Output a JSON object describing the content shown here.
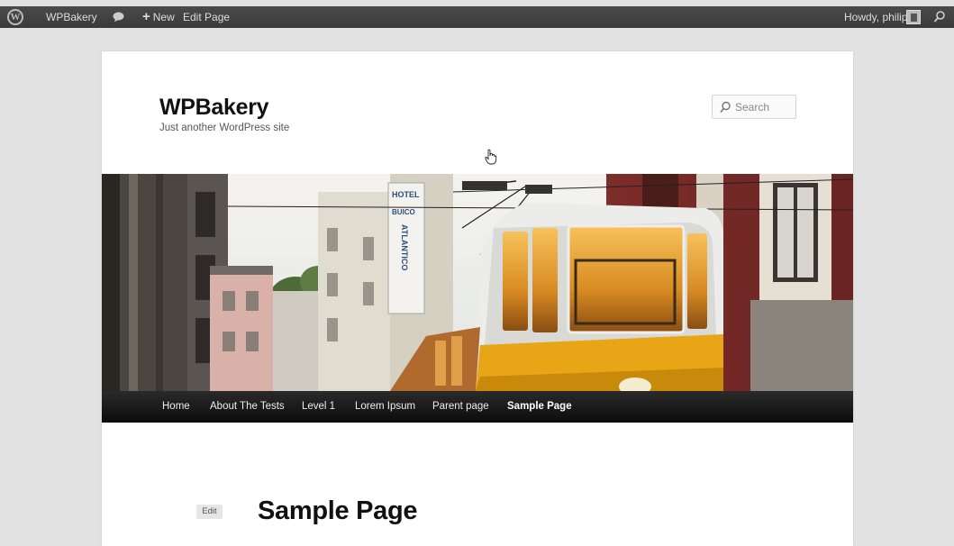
{
  "admin_bar": {
    "site_name": "WPBakery",
    "new_label": "New",
    "edit_label": "Edit Page",
    "howdy": "Howdy, philip",
    "wp_logo": "W",
    "icons": [
      "wordpress-logo-icon",
      "comment-bubble-icon",
      "plus-icon",
      "avatar-icon",
      "search-icon"
    ],
    "bar_color": "#464646"
  },
  "site": {
    "title": "WPBakery",
    "tagline": "Just another WordPress site"
  },
  "search": {
    "placeholder": "Search"
  },
  "header_image": {
    "hotel_sign": [
      "HOTEL",
      "BUICO",
      "ATLANTICO"
    ],
    "tram_color": "#e5a815"
  },
  "nav": {
    "items": [
      {
        "label": "Home"
      },
      {
        "label": "About The Tests"
      },
      {
        "label": "Level 1"
      },
      {
        "label": "Lorem Ipsum"
      },
      {
        "label": "Parent page"
      },
      {
        "label": "Sample Page",
        "current": true
      }
    ]
  },
  "content": {
    "edit_label": "Edit",
    "page_title": "Sample Page"
  }
}
